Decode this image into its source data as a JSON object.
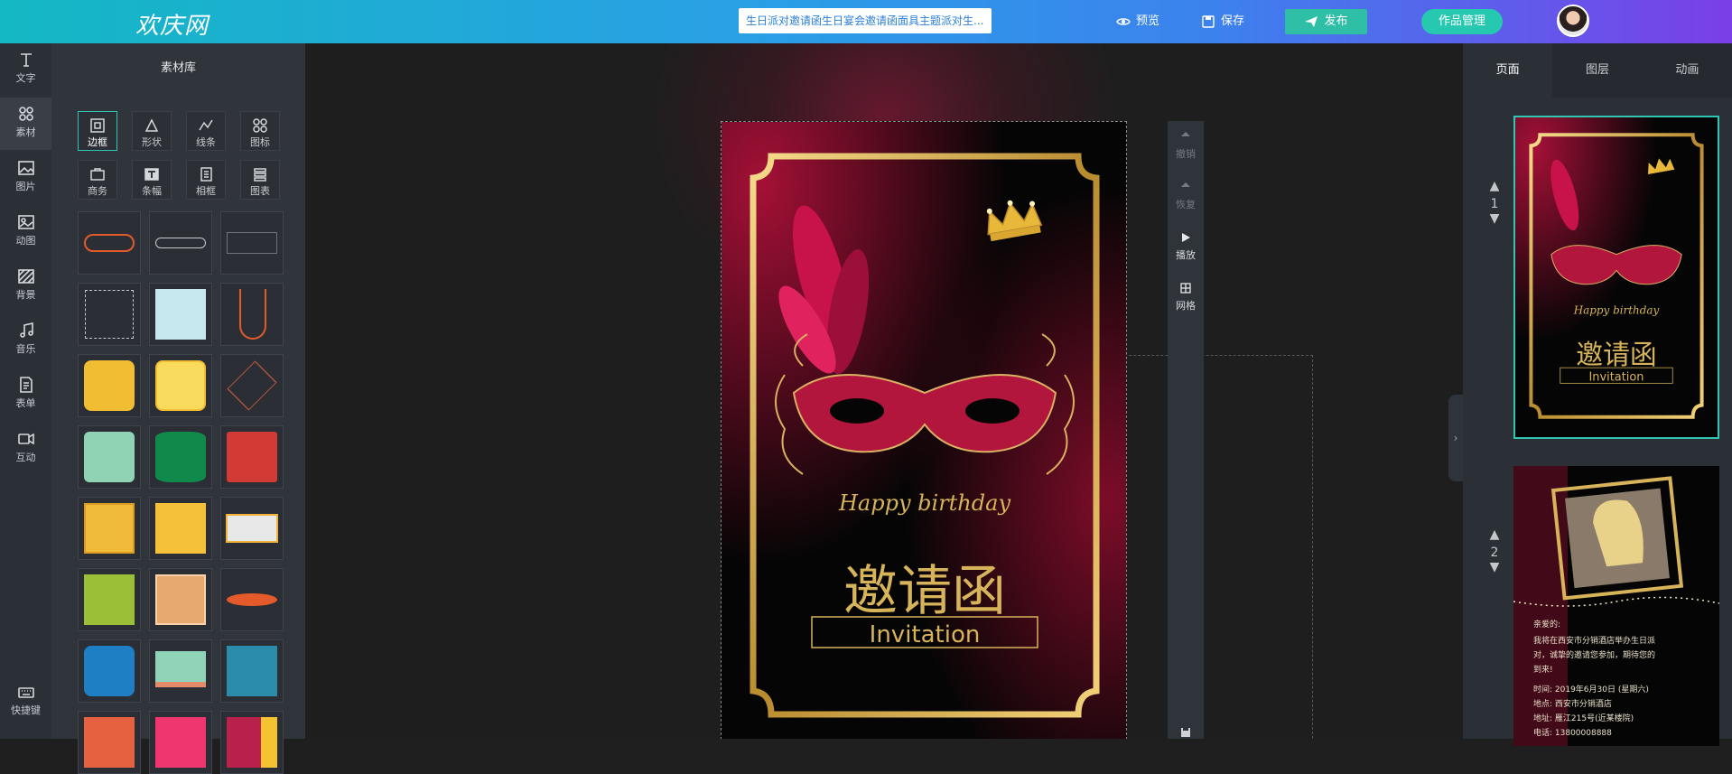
{
  "header": {
    "logo": "欢庆网",
    "search_text": "生日派对邀请函生日宴会邀请函面具主题派对生...",
    "preview_label": "预览",
    "save_label": "保存",
    "publish_label": "发布",
    "works_label": "作品管理"
  },
  "tools": [
    {
      "label": "文字",
      "icon": "text-icon"
    },
    {
      "label": "素材",
      "icon": "material-icon"
    },
    {
      "label": "图片",
      "icon": "image-icon"
    },
    {
      "label": "动图",
      "icon": "gif-icon"
    },
    {
      "label": "背景",
      "icon": "background-icon"
    },
    {
      "label": "音乐",
      "icon": "music-icon"
    },
    {
      "label": "表单",
      "icon": "form-icon"
    },
    {
      "label": "互动",
      "icon": "interaction-icon"
    },
    {
      "label": "快捷键",
      "icon": "keyboard-icon"
    }
  ],
  "material": {
    "title": "素材库",
    "categories": [
      "边框",
      "形状",
      "线条",
      "图标",
      "商务",
      "条幅",
      "相框",
      "图表"
    ]
  },
  "vtoolbar": {
    "undo": "撤销",
    "redo": "恢复",
    "play": "播放",
    "grid": "网格"
  },
  "card": {
    "happy_birthday": "Happy birthday",
    "title_cn": "邀请函",
    "title_en": "Invitation"
  },
  "right": {
    "tabs": [
      "页面",
      "图层",
      "动画"
    ],
    "pages": [
      {
        "num": "1"
      },
      {
        "num": "2"
      }
    ],
    "page2_text": {
      "greeting": "亲爱的:",
      "line1": "我将在西安市分销酒店举办生日派",
      "line2": "对，诚挚的邀请您参加，期待您的",
      "line3": "到来!",
      "time": "时间: 2019年6月30日 (星期六)",
      "place": "地点: 西安市分销酒店",
      "address": "地址: 雁江215号(近某楼院)",
      "phone": "电话: 13800008888"
    }
  },
  "colors": {
    "accent": "#2fc7b3",
    "gold": "#d7b45a",
    "mask_red": "#b2163c"
  }
}
